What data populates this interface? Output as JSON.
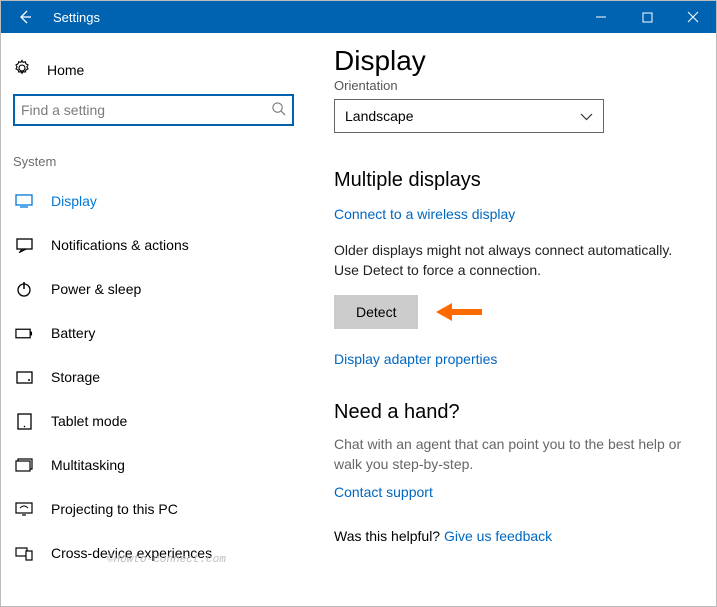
{
  "titlebar": {
    "title": "Settings"
  },
  "sidebar": {
    "home": "Home",
    "search_placeholder": "Find a setting",
    "group": "System",
    "items": [
      {
        "label": "Display",
        "active": true
      },
      {
        "label": "Notifications & actions"
      },
      {
        "label": "Power & sleep"
      },
      {
        "label": "Battery"
      },
      {
        "label": "Storage"
      },
      {
        "label": "Tablet mode"
      },
      {
        "label": "Multitasking"
      },
      {
        "label": "Projecting to this PC"
      },
      {
        "label": "Cross-device experiences"
      }
    ]
  },
  "main": {
    "title": "Display",
    "orientation_label": "Orientation",
    "orientation_value": "Landscape",
    "multiple_title": "Multiple displays",
    "wireless_link": "Connect to a wireless display",
    "detect_text": "Older displays might not always connect automatically. Use Detect to force a connection.",
    "detect_label": "Detect",
    "adapter_link": "Display adapter properties",
    "assist_title": "Need a hand?",
    "assist_text": "Chat with an agent that can point you to the best help or walk you step-by-step.",
    "contact_link": "Contact support",
    "feedback_prompt": "Was this helpful?  ",
    "feedback_link": "Give us feedback"
  },
  "watermark": "©Howto-connect.com"
}
